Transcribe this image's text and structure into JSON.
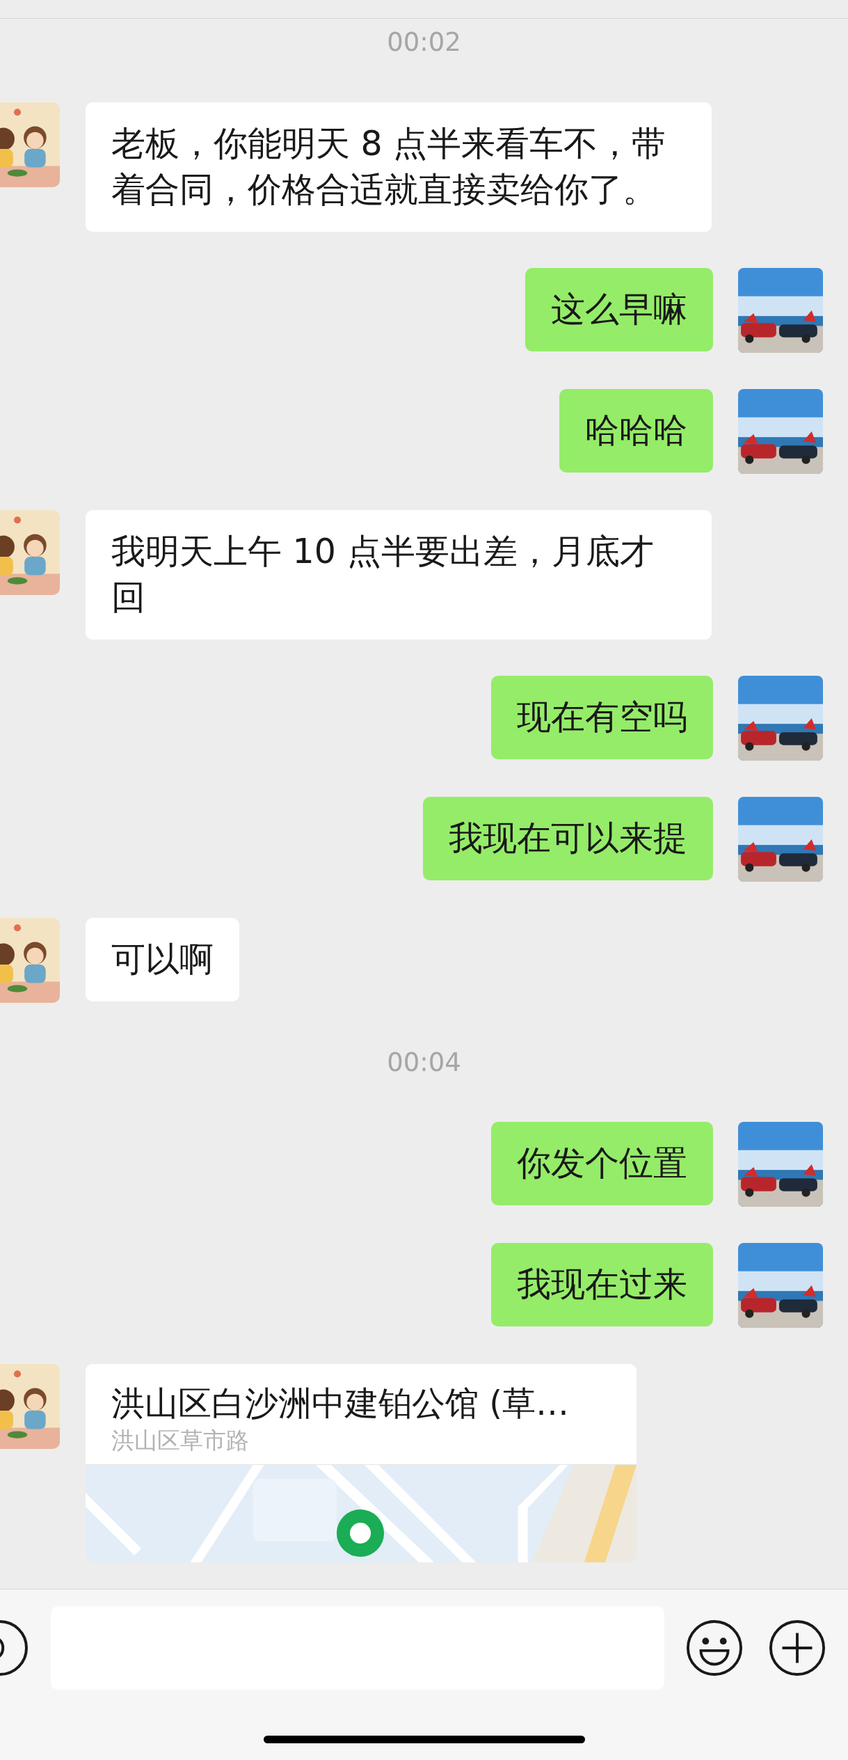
{
  "messages": [
    {
      "kind": "time",
      "text": "00:02"
    },
    {
      "kind": "text",
      "outgoing": false,
      "text": "老板，你能明天 8 点半来看车不，带着合同，价格合适就直接卖给你了。"
    },
    {
      "kind": "text",
      "outgoing": true,
      "text": "这么早嘛"
    },
    {
      "kind": "text",
      "outgoing": true,
      "text": "哈哈哈"
    },
    {
      "kind": "text",
      "outgoing": false,
      "text": "我明天上午 10 点半要出差，月底才回"
    },
    {
      "kind": "text",
      "outgoing": true,
      "text": "现在有空吗"
    },
    {
      "kind": "text",
      "outgoing": true,
      "text": "我现在可以来提"
    },
    {
      "kind": "text",
      "outgoing": false,
      "text": "可以啊"
    },
    {
      "kind": "time",
      "text": "00:04"
    },
    {
      "kind": "text",
      "outgoing": true,
      "text": "你发个位置"
    },
    {
      "kind": "text",
      "outgoing": true,
      "text": "我现在过来"
    },
    {
      "kind": "location",
      "outgoing": false,
      "title": "洪山区白沙洲中建铂公馆 (草…",
      "address": "洪山区草市路"
    }
  ]
}
